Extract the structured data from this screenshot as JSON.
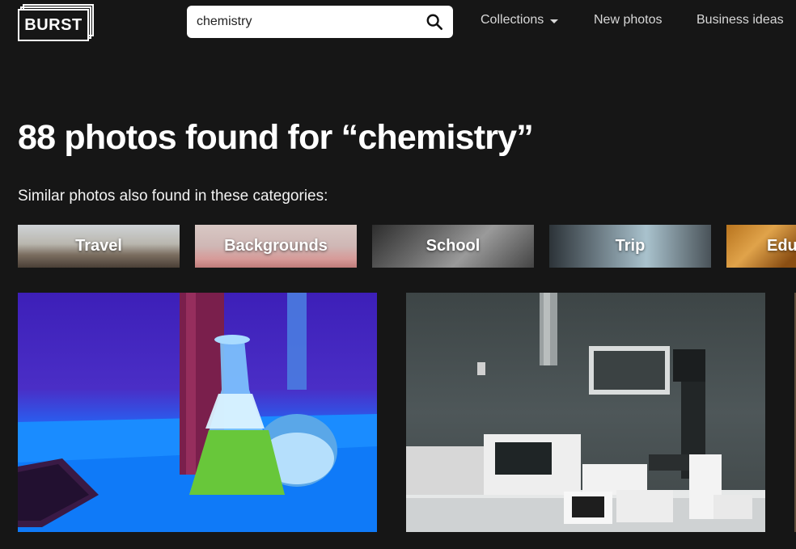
{
  "header": {
    "logo_text": "BURST",
    "search": {
      "value": "chemistry",
      "placeholder": ""
    },
    "nav": {
      "collections": "Collections",
      "new_photos": "New photos",
      "business_ideas": "Business ideas"
    }
  },
  "main": {
    "title": "88 photos found for “chemistry”",
    "subtitle": "Similar photos also found in these categories:",
    "categories": [
      {
        "label": "Travel"
      },
      {
        "label": "Backgrounds"
      },
      {
        "label": "School"
      },
      {
        "label": "Trip"
      },
      {
        "label": "Edu"
      }
    ]
  },
  "colors": {
    "background": "#161616",
    "text": "#ffffff",
    "nav_text": "#d8d8d8"
  },
  "icons": [
    "search-icon",
    "chevron-down-icon"
  ]
}
